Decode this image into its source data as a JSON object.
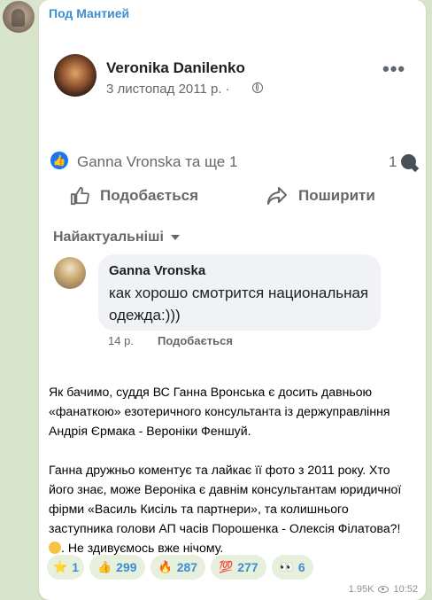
{
  "channel": {
    "name": "Под Мантией"
  },
  "fb_post": {
    "author": "Veronika Danilenko",
    "date": "3 листопад 2011 р. ·",
    "more_icon": "more-horizontal-icon",
    "reactions_text": "Ganna Vronska та ще 1",
    "comment_count": "1",
    "like_action": "Подобається",
    "share_action": "Поширити",
    "sort_label": "Найактуальніші",
    "comment": {
      "author": "Ganna Vronska",
      "text": "как хорошо смотрится национальная одежда:)))",
      "time": "14 р.",
      "like": "Подобається"
    },
    "colors": {
      "like_blue": "#1877f2",
      "meta_gray": "#65676b"
    }
  },
  "message": {
    "paragraph1": "Як бачимо, суддя ВС Ганна Вронська є досить давньою «фанаткою» езотеричного консультанта із держуправління Андрія Єрмака - Вероніки Феншуй.",
    "paragraph2": "Ганна дружньо коментує та лайкає її фото з 2011 року. Хто його знає, може Вероніка є давнім консультантам юридичної фірми «Василь Кисіль та партнери», та колишнього заступника голови АП часів Порошенка - Олексія Філатова?!",
    "paragraph2_end": ". Не здивуємось вже нічому."
  },
  "reactions": [
    {
      "icon": "⭐",
      "name": "star-reaction",
      "count": "1"
    },
    {
      "icon": "👍",
      "name": "thumbs-up-reaction",
      "count": "299"
    },
    {
      "icon": "🔥",
      "name": "fire-reaction",
      "count": "287"
    },
    {
      "icon": "💯",
      "name": "hundred-reaction",
      "count": "277"
    },
    {
      "icon": "👀",
      "name": "eyes-reaction",
      "count": "6"
    }
  ],
  "meta": {
    "views": "1.95K",
    "time": "10:52"
  },
  "theme": {
    "chat_bg": "#d9e4cc",
    "accent": "#3a8ed1"
  }
}
